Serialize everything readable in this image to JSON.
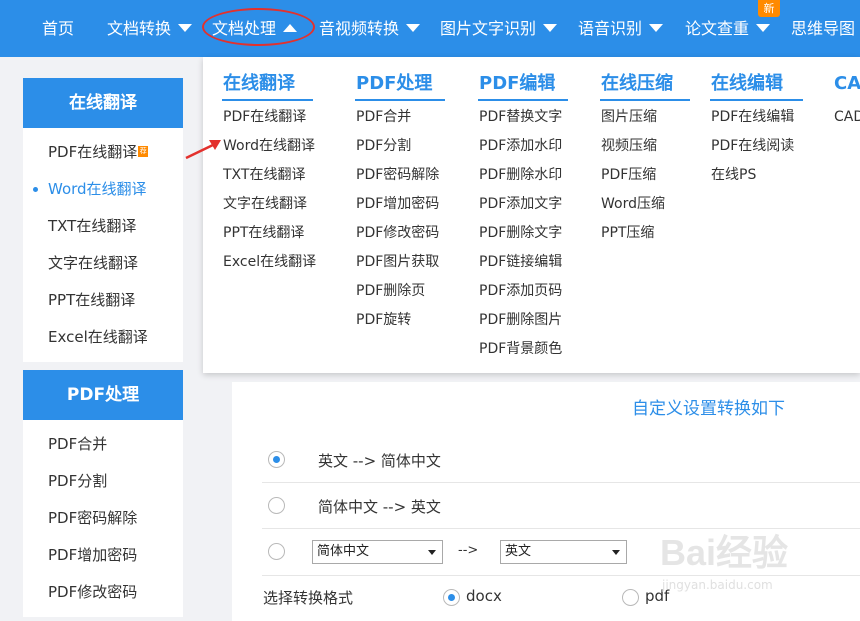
{
  "nav": {
    "items": [
      {
        "label": "首页",
        "caret": ""
      },
      {
        "label": "文档转换",
        "caret": "down"
      },
      {
        "label": "文档处理",
        "caret": "up"
      },
      {
        "label": "音视频转换",
        "caret": "down"
      },
      {
        "label": "图片文字识别",
        "caret": "down"
      },
      {
        "label": "语音识别",
        "caret": "down"
      },
      {
        "label": "论文查重",
        "caret": "down"
      },
      {
        "label": "思维导图",
        "caret": ""
      }
    ],
    "new_badge": "新"
  },
  "sidebar": {
    "panels": [
      {
        "title": "在线翻译",
        "items": [
          "PDF在线翻译",
          "Word在线翻译",
          "TXT在线翻译",
          "文字在线翻译",
          "PPT在线翻译",
          "Excel在线翻译"
        ],
        "badge": "荐"
      },
      {
        "title": "PDF处理",
        "items": [
          "PDF合并",
          "PDF分割",
          "PDF密码解除",
          "PDF增加密码",
          "PDF修改密码"
        ]
      }
    ]
  },
  "dropdown": {
    "columns": [
      {
        "title": "在线翻译",
        "items": [
          "PDF在线翻译",
          "Word在线翻译",
          "TXT在线翻译",
          "文字在线翻译",
          "PPT在线翻译",
          "Excel在线翻译"
        ]
      },
      {
        "title": "PDF处理",
        "items": [
          "PDF合并",
          "PDF分割",
          "PDF密码解除",
          "PDF增加密码",
          "PDF修改密码",
          "PDF图片获取",
          "PDF删除页",
          "PDF旋转"
        ]
      },
      {
        "title": "PDF编辑",
        "items": [
          "PDF替换文字",
          "PDF添加水印",
          "PDF删除水印",
          "PDF添加文字",
          "PDF删除文字",
          "PDF链接编辑",
          "PDF添加页码",
          "PDF删除图片",
          "PDF背景颜色"
        ]
      },
      {
        "title": "在线压缩",
        "items": [
          "图片压缩",
          "视频压缩",
          "PDF压缩",
          "Word压缩",
          "PPT压缩"
        ]
      },
      {
        "title": "在线编辑",
        "items": [
          "PDF在线编辑",
          "PDF在线阅读",
          "在线PS"
        ]
      },
      {
        "title": "CA",
        "items": [
          "CAD"
        ]
      }
    ]
  },
  "main": {
    "custom_title": "自定义设置转换如下",
    "options": [
      {
        "label": "英文 --> 简体中文",
        "checked": true
      },
      {
        "label": "简体中文 --> 英文",
        "checked": false
      }
    ],
    "custom_row": {
      "from": "简体中文",
      "arrow": "-->",
      "to": "英文"
    },
    "format_label": "选择转换格式",
    "formats": [
      {
        "label": "docx",
        "checked": true
      },
      {
        "label": "pdf",
        "checked": false
      }
    ]
  },
  "watermark": {
    "text": "Bai经验",
    "sub": "jingyan.baidu.com"
  },
  "colors": {
    "primary": "#2c8ee8",
    "sidebar_bg": "#f1f2f5",
    "annotation_red": "#e3312d",
    "badge_orange": "#ff8a00"
  }
}
